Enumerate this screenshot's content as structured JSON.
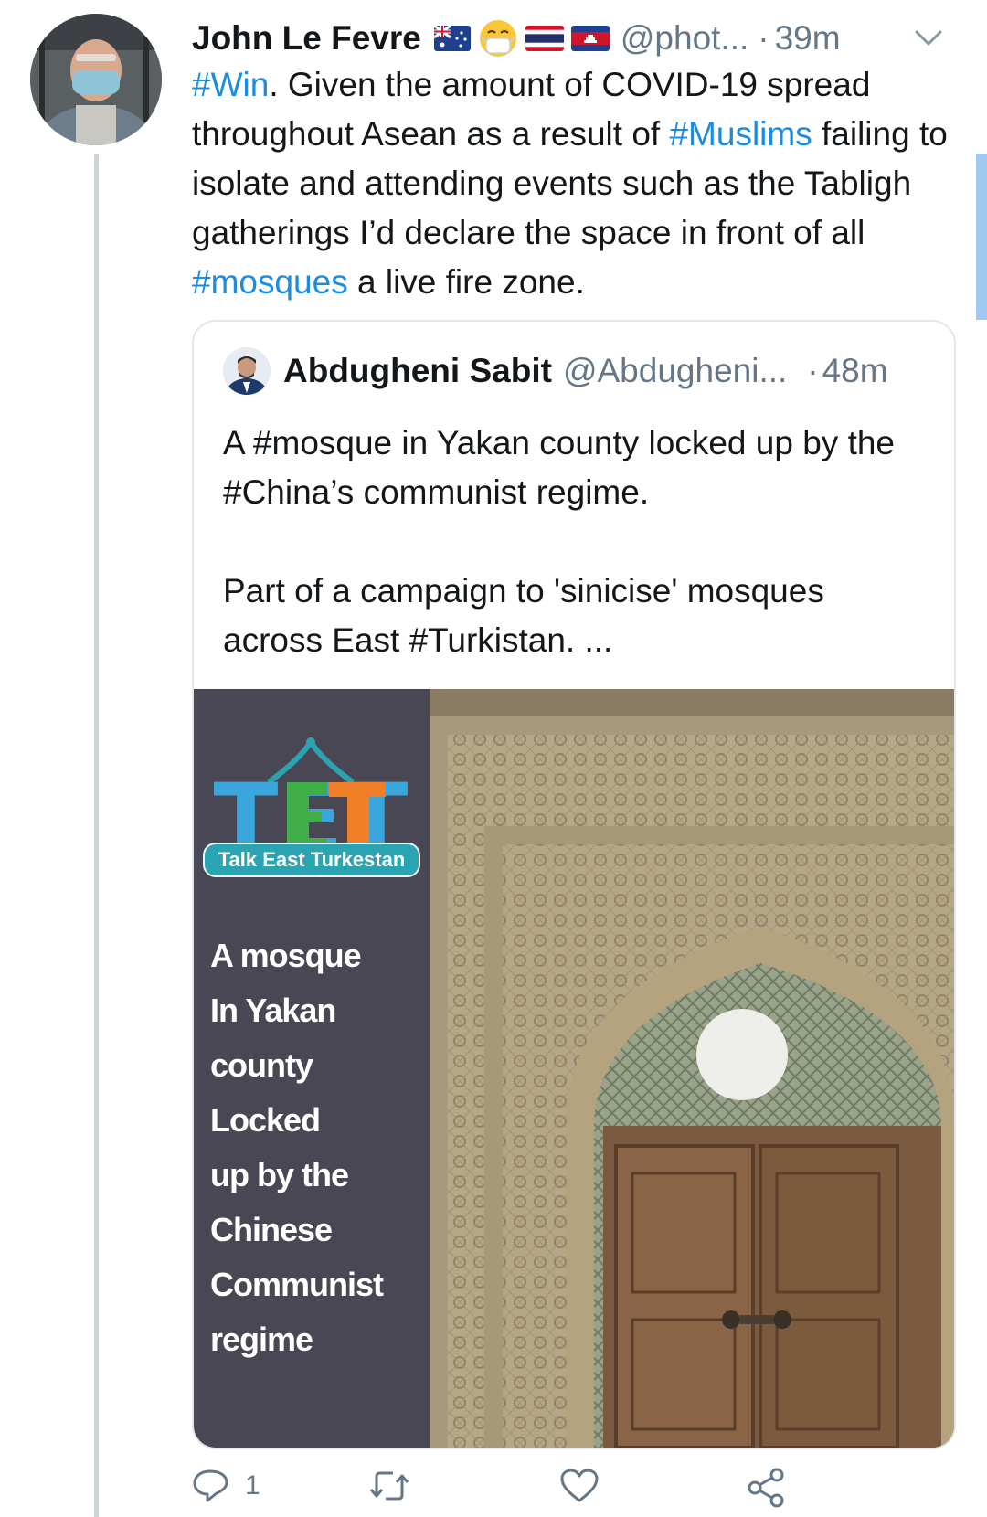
{
  "tweet": {
    "author_name": "John Le Fevre",
    "author_handle": "@phot...",
    "separator": "·",
    "time": "39m",
    "flags": [
      "australia-flag-icon",
      "face-mask-emoji-icon",
      "thailand-flag-icon",
      "cambodia-flag-icon"
    ],
    "text": {
      "h1": "#Win",
      "t1": ". Given the amount of COVID-19 spread throughout Asean as a result of ",
      "h2": "#Muslims",
      "t2": " failing to isolate and attending events such as the Tabligh gatherings I’d declare the space in front of all ",
      "h3": "#mosques",
      "t3": " a live fire zone."
    }
  },
  "quoted_tweet": {
    "author_name": "Abdugheni Sabit",
    "author_handle": "@Abdugheni...",
    "separator": "·",
    "time": "48m",
    "paragraph1": "A #mosque in Yakan county locked up by the #China’s communist regime.",
    "paragraph2": "Part of a campaign to 'sinicise' mosques across East #Turkistan. ...",
    "media": {
      "logo_text": "TET",
      "logo_subtitle": "Talk East Turkestan",
      "overlay_lines": [
        "A mosque",
        "In Yakan",
        "county",
        "Locked",
        "up by the",
        "Chinese",
        "Communist",
        "regime"
      ]
    }
  },
  "actions": {
    "reply_count": "1",
    "retweet_count": "",
    "like_count": ""
  },
  "colors": {
    "hashtag": "#1d8ce0",
    "muted": "#657786",
    "thread_line": "#ccd6dd"
  }
}
